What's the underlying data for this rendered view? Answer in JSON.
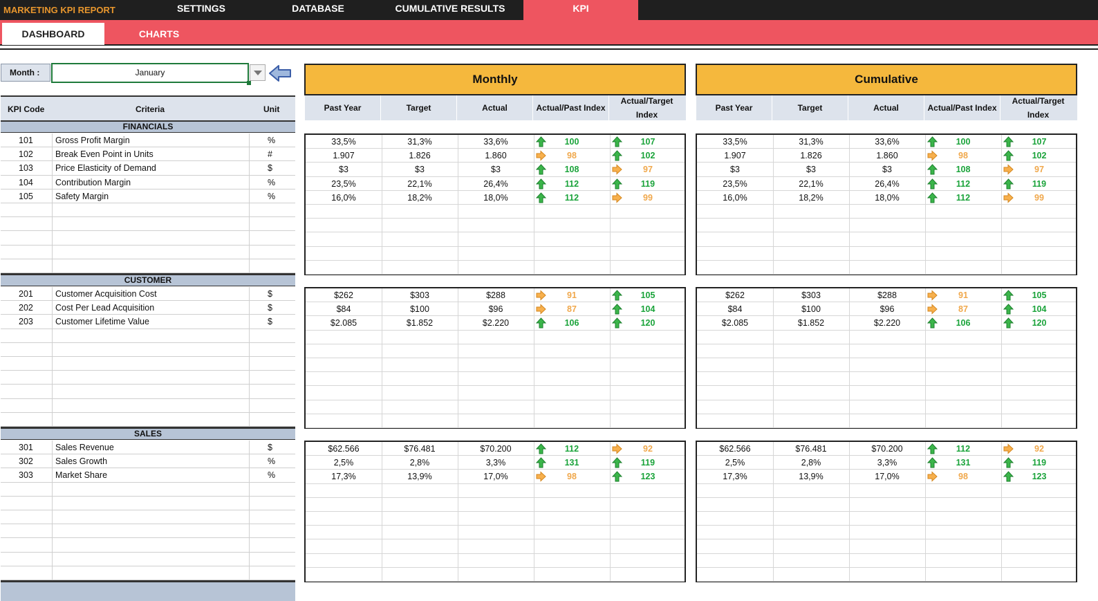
{
  "app_title": "MARKETING KPI REPORT",
  "top_tabs": [
    {
      "label": "SETTINGS"
    },
    {
      "label": "DATABASE"
    },
    {
      "label": "CUMULATIVE RESULTS"
    },
    {
      "label": "KPI"
    }
  ],
  "sub_tabs": [
    {
      "label": "DASHBOARD"
    },
    {
      "label": "CHARTS"
    }
  ],
  "month": {
    "label": "Month :",
    "value": "January"
  },
  "columns": {
    "kpi_code": "KPI Code",
    "criteria": "Criteria",
    "unit": "Unit"
  },
  "panel_columns": [
    "Past Year",
    "Target",
    "Actual",
    "Actual/Past Index",
    "Actual/Target Index"
  ],
  "panels": [
    {
      "title": "Monthly"
    },
    {
      "title": "Cumulative"
    }
  ],
  "colors": {
    "accent_red": "#ee5560",
    "accent_gold": "#f5b83d",
    "dark": "#1f1f1f",
    "up_green": "#1aa33a",
    "flat_orange": "#f0a84c"
  },
  "icons": {
    "up": "arrow-up-icon",
    "flat": "arrow-right-icon"
  },
  "sections": [
    {
      "name": "FINANCIALS",
      "rows": [
        {
          "code": "101",
          "criteria": "Gross Profit Margin",
          "unit": "%",
          "monthly": [
            "33,5%",
            "31,3%",
            "33,6%",
            "100",
            "107"
          ],
          "m_icons": [
            "up",
            "up"
          ],
          "cumulative": [
            "33,5%",
            "31,3%",
            "33,6%",
            "100",
            "107"
          ],
          "c_icons": [
            "up",
            "up"
          ]
        },
        {
          "code": "102",
          "criteria": "Break Even Point in Units",
          "unit": "#",
          "monthly": [
            "1.907",
            "1.826",
            "1.860",
            "98",
            "102"
          ],
          "m_icons": [
            "flat",
            "up"
          ],
          "cumulative": [
            "1.907",
            "1.826",
            "1.860",
            "98",
            "102"
          ],
          "c_icons": [
            "flat",
            "up"
          ]
        },
        {
          "code": "103",
          "criteria": "Price Elasticity of Demand",
          "unit": "$",
          "monthly": [
            "$3",
            "$3",
            "$3",
            "108",
            "97"
          ],
          "m_icons": [
            "up",
            "flat"
          ],
          "cumulative": [
            "$3",
            "$3",
            "$3",
            "108",
            "97"
          ],
          "c_icons": [
            "up",
            "flat"
          ]
        },
        {
          "code": "104",
          "criteria": "Contribution Margin",
          "unit": "%",
          "monthly": [
            "23,5%",
            "22,1%",
            "26,4%",
            "112",
            "119"
          ],
          "m_icons": [
            "up",
            "up"
          ],
          "cumulative": [
            "23,5%",
            "22,1%",
            "26,4%",
            "112",
            "119"
          ],
          "c_icons": [
            "up",
            "up"
          ]
        },
        {
          "code": "105",
          "criteria": "Safety Margin",
          "unit": "%",
          "monthly": [
            "16,0%",
            "18,2%",
            "18,0%",
            "112",
            "99"
          ],
          "m_icons": [
            "up",
            "flat"
          ],
          "cumulative": [
            "16,0%",
            "18,2%",
            "18,0%",
            "112",
            "99"
          ],
          "c_icons": [
            "up",
            "flat"
          ]
        }
      ]
    },
    {
      "name": "CUSTOMER",
      "rows": [
        {
          "code": "201",
          "criteria": "Customer Acquisition Cost",
          "unit": "$",
          "monthly": [
            "$262",
            "$303",
            "$288",
            "91",
            "105"
          ],
          "m_icons": [
            "flat",
            "up"
          ],
          "cumulative": [
            "$262",
            "$303",
            "$288",
            "91",
            "105"
          ],
          "c_icons": [
            "flat",
            "up"
          ]
        },
        {
          "code": "202",
          "criteria": "Cost Per Lead Acquisition",
          "unit": "$",
          "monthly": [
            "$84",
            "$100",
            "$96",
            "87",
            "104"
          ],
          "m_icons": [
            "flat",
            "up"
          ],
          "cumulative": [
            "$84",
            "$100",
            "$96",
            "87",
            "104"
          ],
          "c_icons": [
            "flat",
            "up"
          ]
        },
        {
          "code": "203",
          "criteria": "Customer Lifetime Value",
          "unit": "$",
          "monthly": [
            "$2.085",
            "$1.852",
            "$2.220",
            "106",
            "120"
          ],
          "m_icons": [
            "up",
            "up"
          ],
          "cumulative": [
            "$2.085",
            "$1.852",
            "$2.220",
            "106",
            "120"
          ],
          "c_icons": [
            "up",
            "up"
          ]
        }
      ]
    },
    {
      "name": "SALES",
      "rows": [
        {
          "code": "301",
          "criteria": "Sales Revenue",
          "unit": "$",
          "monthly": [
            "$62.566",
            "$76.481",
            "$70.200",
            "112",
            "92"
          ],
          "m_icons": [
            "up",
            "flat"
          ],
          "cumulative": [
            "$62.566",
            "$76.481",
            "$70.200",
            "112",
            "92"
          ],
          "c_icons": [
            "up",
            "flat"
          ]
        },
        {
          "code": "302",
          "criteria": "Sales Growth",
          "unit": "%",
          "monthly": [
            "2,5%",
            "2,8%",
            "3,3%",
            "131",
            "119"
          ],
          "m_icons": [
            "up",
            "up"
          ],
          "cumulative": [
            "2,5%",
            "2,8%",
            "3,3%",
            "131",
            "119"
          ],
          "c_icons": [
            "up",
            "up"
          ]
        },
        {
          "code": "303",
          "criteria": "Market Share",
          "unit": "%",
          "monthly": [
            "17,3%",
            "13,9%",
            "17,0%",
            "98",
            "123"
          ],
          "m_icons": [
            "flat",
            "up"
          ],
          "cumulative": [
            "17,3%",
            "13,9%",
            "17,0%",
            "98",
            "123"
          ],
          "c_icons": [
            "flat",
            "up"
          ]
        }
      ]
    }
  ]
}
